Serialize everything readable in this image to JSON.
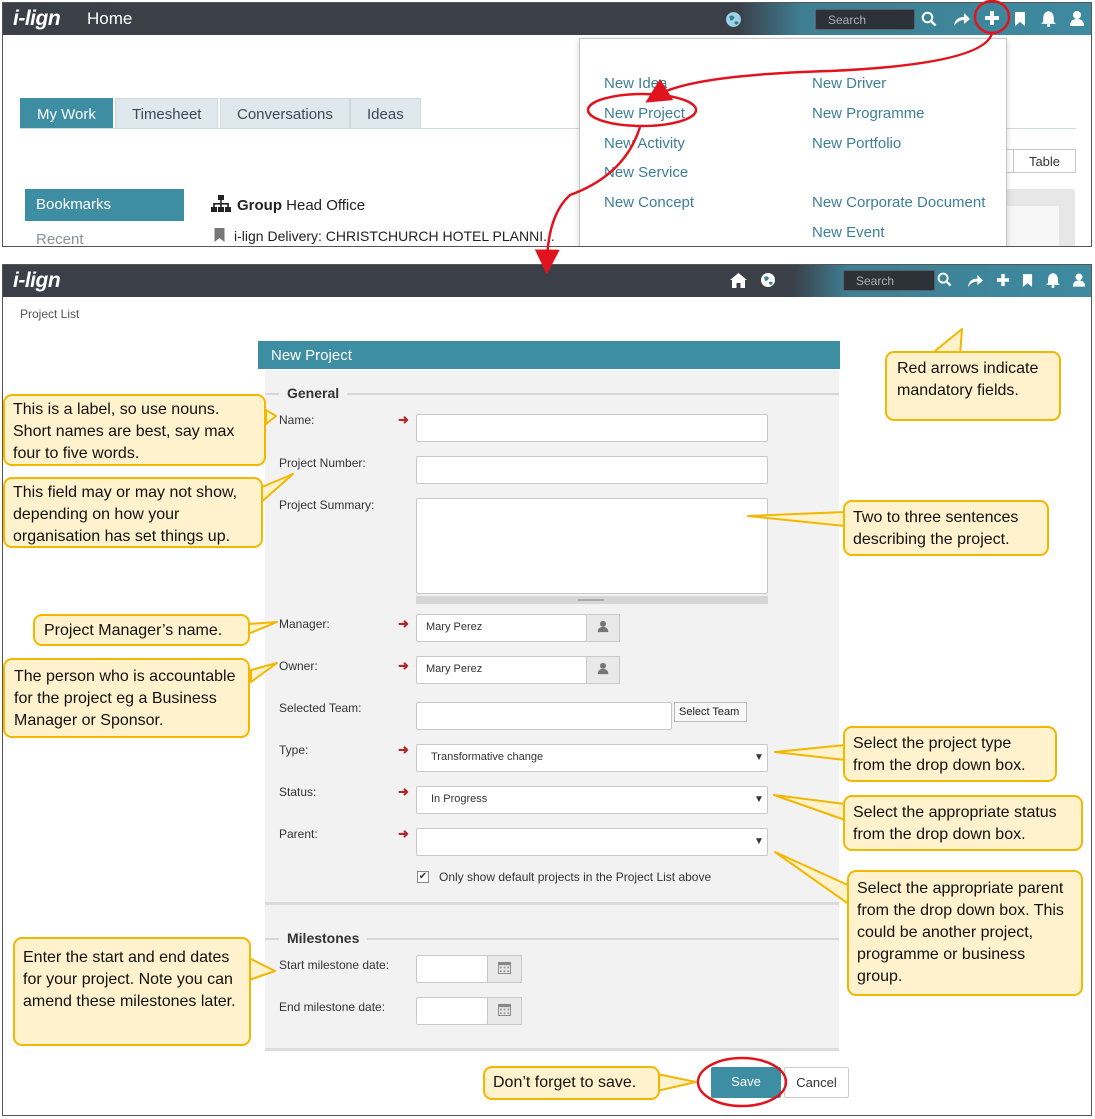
{
  "top": {
    "logo": "i-lign",
    "nav_title": "Home",
    "search_placeholder": "Search",
    "tabs": [
      "My Work",
      "Timesheet",
      "Conversations",
      "Ideas"
    ],
    "sidebar": {
      "bookmarks": "Bookmarks",
      "recent": "Recent"
    },
    "bookmarks": [
      {
        "bold": "Group",
        "text": " Head Office"
      },
      {
        "bold": "",
        "text": "i-lign Delivery: CHRISTCHURCH HOTEL PLANNI..."
      }
    ],
    "table_button": "Table",
    "dropdown": {
      "left": [
        "New Idea",
        "New Project",
        "New Activity",
        "New Service",
        "New Concept"
      ],
      "right": [
        "New Driver",
        "New Programme",
        "New Portfolio",
        "New Corporate Document",
        "New Event"
      ]
    }
  },
  "bottom": {
    "logo": "i-lign",
    "search_placeholder": "Search",
    "breadcrumb": "Project List",
    "form_title": "New Project",
    "sections": {
      "general": "General",
      "milestones": "Milestones"
    },
    "fields": {
      "name": {
        "label": "Name:",
        "value": ""
      },
      "project_number": {
        "label": "Project Number:",
        "value": ""
      },
      "project_summary": {
        "label": "Project Summary:",
        "value": ""
      },
      "manager": {
        "label": "Manager:",
        "value": "Mary Perez"
      },
      "owner": {
        "label": "Owner:",
        "value": "Mary Perez"
      },
      "selected_team": {
        "label": "Selected Team:",
        "value": "",
        "button": "Select Team"
      },
      "type": {
        "label": "Type:",
        "value": "Transformative change"
      },
      "status": {
        "label": "Status:",
        "value": "In Progress"
      },
      "parent": {
        "label": "Parent:",
        "value": ""
      },
      "default_only": {
        "label": "Only show default projects in the Project List above",
        "checked": true
      },
      "start_milestone": {
        "label": "Start milestone date:",
        "value": ""
      },
      "end_milestone": {
        "label": "End milestone date:",
        "value": ""
      }
    },
    "save": "Save",
    "cancel": "Cancel"
  },
  "callouts": {
    "mandatory": "Red arrows indicate mandatory fields.",
    "name": "This is a label, so use nouns.  Short names are best, say max four to five  words.",
    "project_number": "This field may or may not show, depending on how your organisation has set things up.",
    "summary": "Two to three sentences describing the project.",
    "manager": "Project Manager’s name.",
    "owner": "The person who is accountable for the project eg a Business Manager or Sponsor.",
    "type": "Select the project type from the drop down box.",
    "status": "Select the appropriate status from the drop down box.",
    "parent": "Select the appropriate parent from the drop down box. This could be another project, programme or business group.",
    "milestones": "Enter the start and end dates for your project. Note you can amend these milestones later.",
    "save": "Don’t forget to save."
  },
  "colors": {
    "navbar": "#3a3f48",
    "teal": "#3d8da3",
    "link": "#3d7f98",
    "required_arrow": "#b0282c",
    "callout_fill": "#fff2cc",
    "callout_border": "#f2b700",
    "annotation_red": "#e0141e"
  },
  "icons": [
    "globe-icon",
    "home-icon",
    "search-icon",
    "share-icon",
    "plus-icon",
    "bookmark-icon",
    "bell-icon",
    "user-icon",
    "hierarchy-icon",
    "person-icon",
    "calendar-icon",
    "chevron-down-icon",
    "checkbox-icon"
  ]
}
